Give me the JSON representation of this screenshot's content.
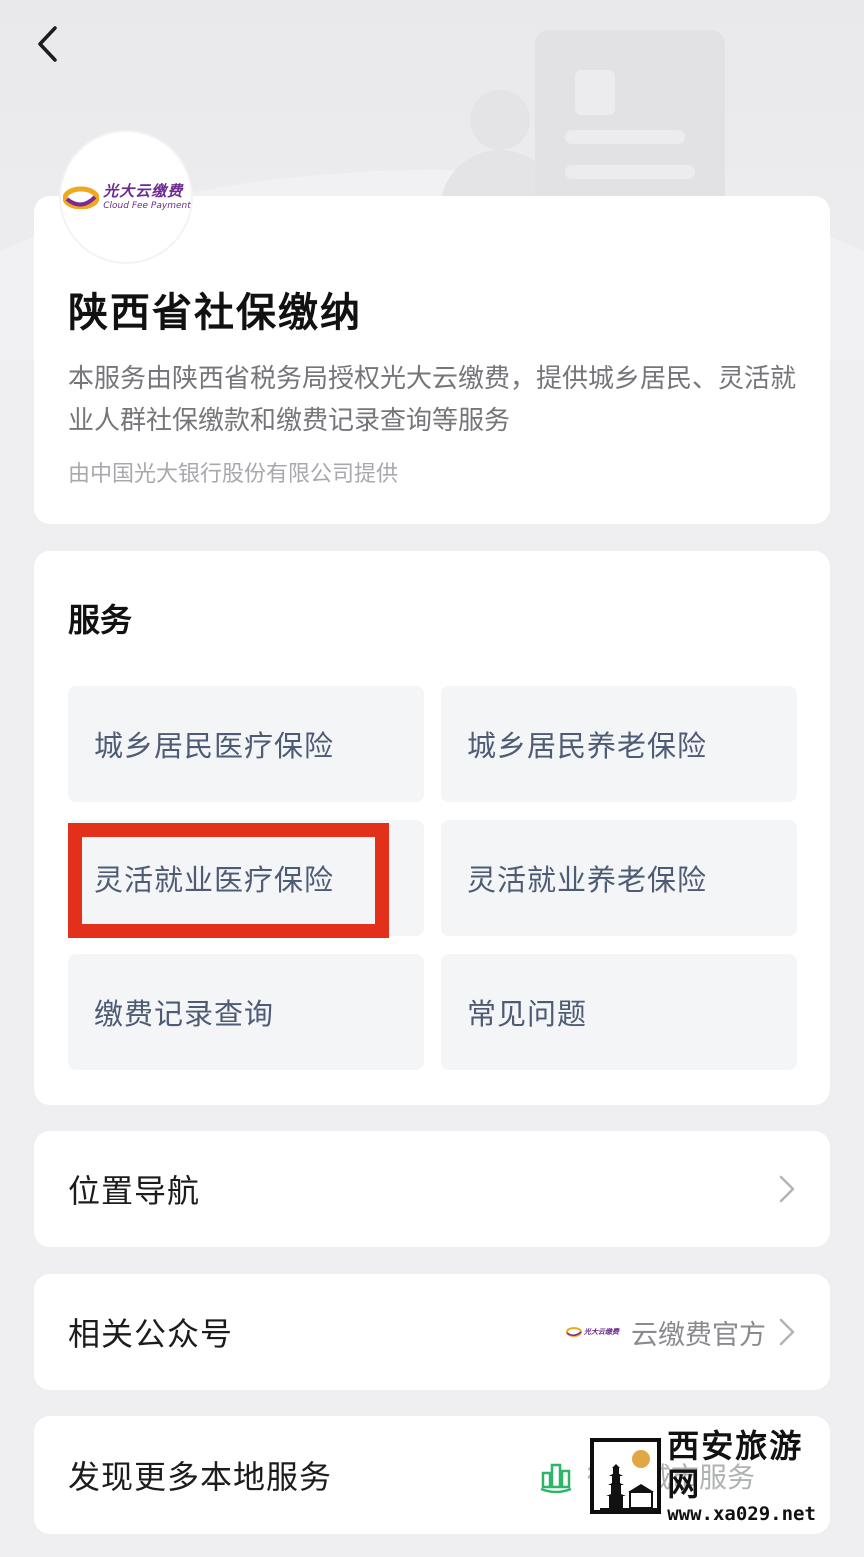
{
  "header": {
    "back_icon": "chevron-left-icon"
  },
  "logo": {
    "cn_text": "光大云缴费",
    "en_text": "Cloud Fee Payment"
  },
  "info": {
    "title": "陕西省社保缴纳",
    "description": "本服务由陕西省税务局授权光大云缴费，提供城乡居民、灵活就业人群社保缴款和缴费记录查询等服务",
    "provider": "由中国光大银行股份有限公司提供"
  },
  "services": {
    "title": "服务",
    "items": [
      "城乡居民医疗保险",
      "城乡居民养老保险",
      "灵活就业医疗保险",
      "灵活就业养老保险",
      "缴费记录查询",
      "常见问题"
    ],
    "highlight_color": "#e2301a"
  },
  "nav": {
    "label": "位置导航"
  },
  "official_account": {
    "label": "相关公众号",
    "value": "云缴费官方"
  },
  "more_services": {
    "label": "发现更多本地服务",
    "right_text": "微信城市服务"
  },
  "watermark": {
    "title": "西安旅游网",
    "url": "www.xa029.net"
  },
  "colors": {
    "background": "#efeff1",
    "card": "#ffffff",
    "service_text": "#4e5b74",
    "brand_purple": "#6b2b8f"
  }
}
